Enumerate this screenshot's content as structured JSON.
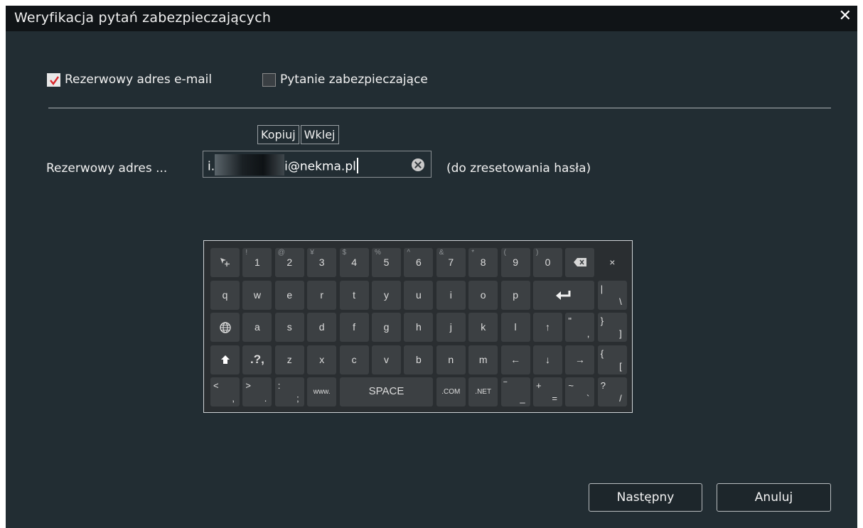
{
  "dialog": {
    "title": "Weryfikacja pytań zabezpieczających",
    "close_label": "✕"
  },
  "options": [
    {
      "label": "Rezerwowy adres e-mail",
      "checked": true
    },
    {
      "label": "Pytanie zabezpieczające",
      "checked": false
    }
  ],
  "clipboard": {
    "copy_label": "Kopiuj",
    "paste_label": "Wklej"
  },
  "email": {
    "label": "Rezerwowy adres ...",
    "value_start": "i.",
    "value_end": "i@nekma.pl",
    "hint": "(do zresetowania hasła)"
  },
  "keyboard": {
    "rows": [
      [
        {
          "icon": "move-icon"
        },
        {
          "main": "1",
          "shift": "!"
        },
        {
          "main": "2",
          "shift": "@"
        },
        {
          "main": "3",
          "shift": "¥"
        },
        {
          "main": "4",
          "shift": "$"
        },
        {
          "main": "5",
          "shift": "%"
        },
        {
          "main": "6",
          "shift": "^"
        },
        {
          "main": "7",
          "shift": "&"
        },
        {
          "main": "8",
          "shift": "*"
        },
        {
          "main": "9",
          "shift": "("
        },
        {
          "main": "0",
          "shift": ")"
        },
        {
          "icon": "backspace-icon"
        },
        {
          "main": "×",
          "plain": true
        }
      ],
      [
        {
          "main": "q"
        },
        {
          "main": "w"
        },
        {
          "main": "e"
        },
        {
          "main": "r"
        },
        {
          "main": "t"
        },
        {
          "main": "y"
        },
        {
          "main": "u"
        },
        {
          "main": "i"
        },
        {
          "main": "o"
        },
        {
          "main": "p"
        },
        {
          "icon": "enter-icon",
          "span": 2
        },
        {
          "dual": [
            "|",
            "\\"
          ]
        }
      ],
      [
        {
          "icon": "globe-icon"
        },
        {
          "main": "a"
        },
        {
          "main": "s"
        },
        {
          "main": "d"
        },
        {
          "main": "f"
        },
        {
          "main": "g"
        },
        {
          "main": "h"
        },
        {
          "main": "j"
        },
        {
          "main": "k"
        },
        {
          "main": "l"
        },
        {
          "main": "↑"
        },
        {
          "dual": [
            "\"",
            ","
          ]
        },
        {
          "dual": [
            "}",
            "]"
          ]
        }
      ],
      [
        {
          "icon": "shift-icon"
        },
        {
          "main": ".?,"
        },
        {
          "main": "z"
        },
        {
          "main": "x"
        },
        {
          "main": "c"
        },
        {
          "main": "v"
        },
        {
          "main": "b"
        },
        {
          "main": "n"
        },
        {
          "main": "m"
        },
        {
          "main": "←"
        },
        {
          "main": "↓"
        },
        {
          "main": "→"
        },
        {
          "dual": [
            "{",
            "["
          ]
        }
      ],
      [
        {
          "dual": [
            "<",
            ","
          ]
        },
        {
          "dual": [
            ">",
            "."
          ]
        },
        {
          "dual": [
            ":",
            ";"
          ]
        },
        {
          "main": "www.",
          "small": true
        },
        {
          "main": "SPACE",
          "span": 3
        },
        {
          "main": ".COM",
          "small": true
        },
        {
          "main": ".NET",
          "small": true
        },
        {
          "dual": [
            "‾",
            "_"
          ]
        },
        {
          "dual": [
            "+",
            "="
          ]
        },
        {
          "dual": [
            "~",
            "`"
          ]
        },
        {
          "dual": [
            "?",
            "/"
          ]
        }
      ]
    ]
  },
  "buttons": {
    "next_label": "Następny",
    "cancel_label": "Anuluj"
  }
}
